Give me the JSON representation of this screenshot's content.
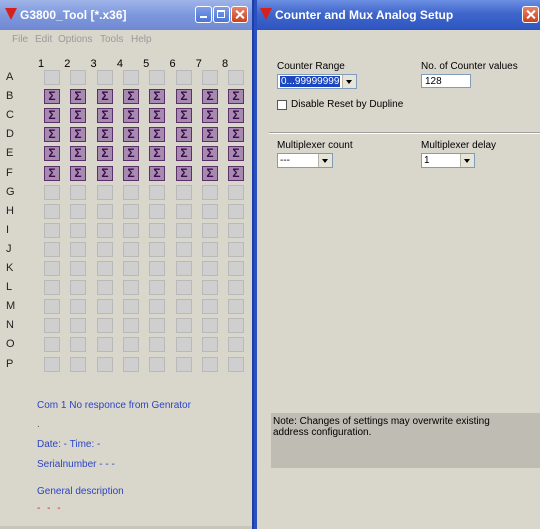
{
  "left_window": {
    "title": "G3800_Tool [*.x36]",
    "menu": [
      "File",
      "Edit",
      "Options",
      "Tools",
      "Help"
    ],
    "columns": [
      "1",
      "2",
      "3",
      "4",
      "5",
      "6",
      "7",
      "8"
    ],
    "rows": [
      "A",
      "B",
      "C",
      "D",
      "E",
      "F",
      "G",
      "H",
      "I",
      "J",
      "K",
      "L",
      "M",
      "N",
      "O",
      "P"
    ],
    "sigma_rows": [
      "B",
      "C",
      "D",
      "E",
      "F"
    ],
    "sigma_symbol": "Σ",
    "status": {
      "com_message": "Com 1 No responce from Genrator",
      "dot": ".",
      "date_time": "Date: - Time: -",
      "serial": "Serialnumber - - -",
      "general_description": "General description",
      "dashes": "- - -"
    }
  },
  "right_window": {
    "title": "Counter and Mux Analog Setup",
    "counter_range_label": "Counter Range",
    "counter_range_value": "0...99999999",
    "num_counter_values_label": "No. of Counter values",
    "num_counter_values": "128",
    "disable_reset_label": "Disable Reset by Dupline",
    "mux_count_label": "Multiplexer count",
    "mux_count_value": "---",
    "mux_delay_label": "Multiplexer delay",
    "mux_delay_value": "1",
    "note": "Note: Changes of settings may overwrite existing address configuration."
  }
}
